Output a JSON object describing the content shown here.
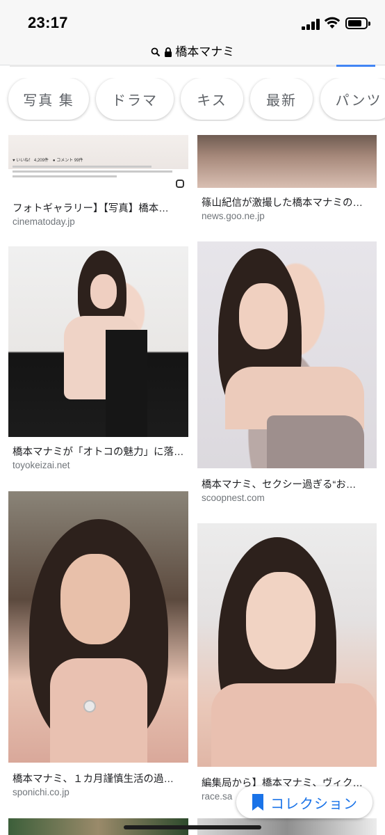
{
  "status_bar": {
    "time": "23:17"
  },
  "url_bar": {
    "domain": "橋本マナミ"
  },
  "chips": [
    "写真 集",
    "ドラマ",
    "キス",
    "最新",
    "パンツ"
  ],
  "results": [
    {
      "caption": "フォトギャラリー】【写真】橋本…",
      "source": "cinematoday.jp",
      "thumb_text": "♥ いいね！ 4,209件　● コメント 99件"
    },
    {
      "caption": "篠山紀信が激撮した橋本マナミの…",
      "source": "news.goo.ne.jp"
    },
    {
      "caption": "橋本マナミが「オトコの魅力」に落…",
      "source": "toyokeizai.net"
    },
    {
      "caption": "橋本マナミ、セクシー過ぎる“お…",
      "source": "scoopnest.com"
    },
    {
      "caption": "橋本マナミ、１カ月謹慎生活の過…",
      "source": "sponichi.co.jp"
    },
    {
      "caption": "編集局から】橋本マナミ、ヴィク…",
      "source": "race.sa"
    }
  ],
  "collection_button": {
    "label": "コレクション"
  },
  "colors": {
    "accent": "#1a73e8",
    "caption": "#202124",
    "source": "#70757a"
  }
}
